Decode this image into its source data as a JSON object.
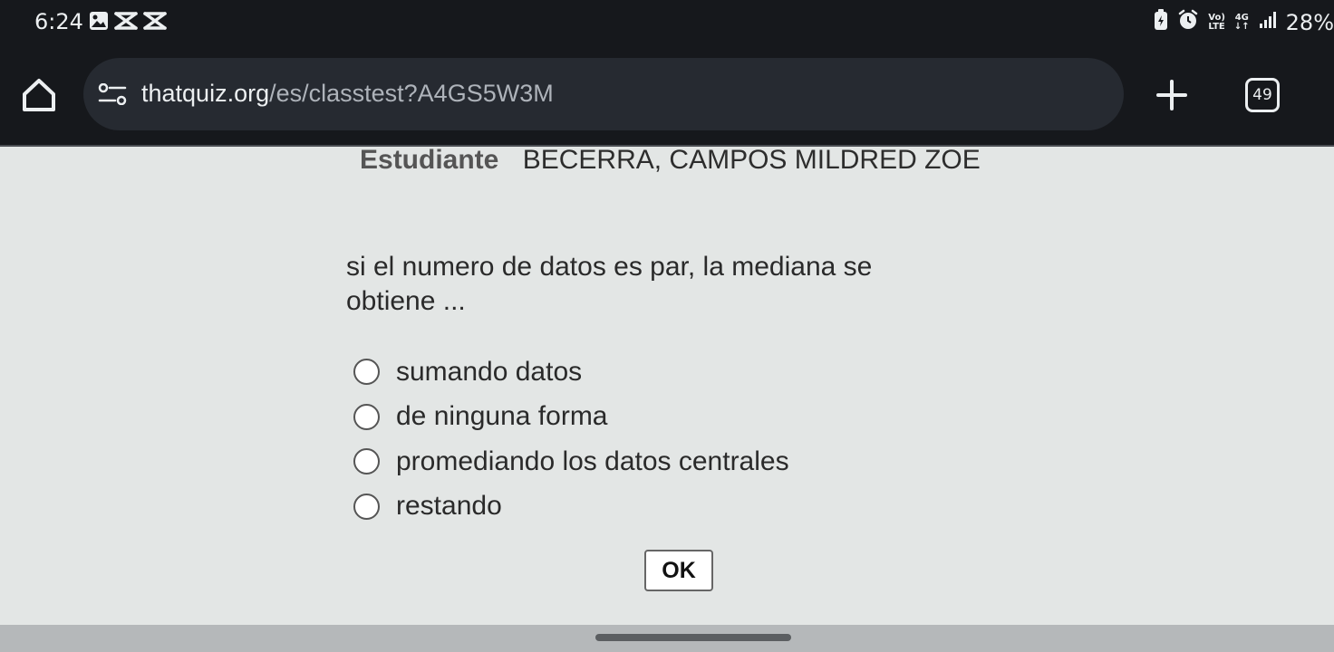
{
  "status_bar": {
    "time": "6:24",
    "volte_top": "Vo)",
    "volte_bottom": "LTE",
    "net_top": "4G",
    "net_bottom": "↓↑",
    "battery": "28%"
  },
  "browser": {
    "url_host": "thatquiz.org",
    "url_path": "/es/classtest?A4GS5W3M",
    "tab_count": "49"
  },
  "page": {
    "student_label": "Estudiante",
    "student_name": "BECERRA, CAMPOS MILDRED ZOE",
    "question": "si el numero de datos es par, la mediana se obtiene ...",
    "options": [
      "sumando datos",
      "de ninguna forma",
      "promediando los datos centrales",
      "restando"
    ],
    "ok_label": "OK"
  },
  "colors": {
    "browser_bg": "#16181c",
    "url_box": "#262a31",
    "page_bg": "#e3e6e5"
  }
}
